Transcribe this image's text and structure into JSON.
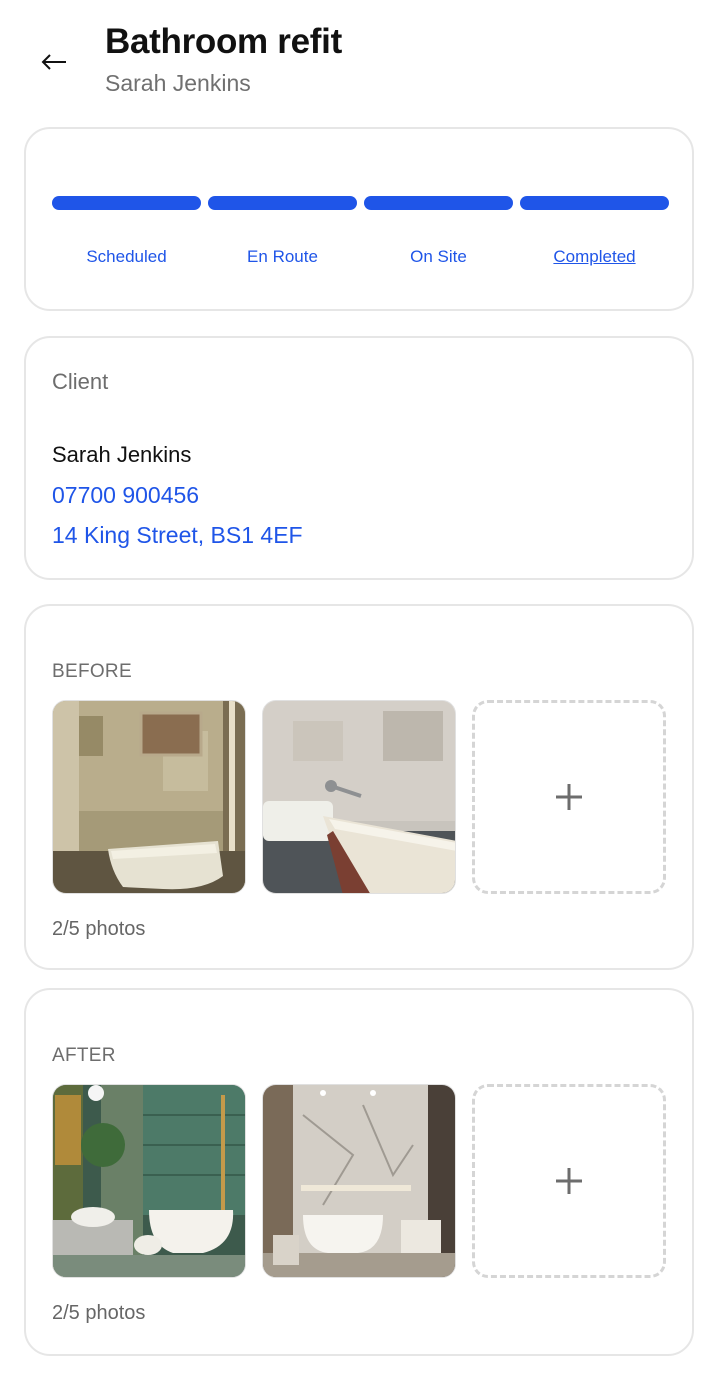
{
  "header": {
    "title": "Bathroom refit",
    "subtitle": "Sarah Jenkins",
    "back_icon": "arrow-left-icon"
  },
  "status": {
    "steps": [
      "Scheduled",
      "En Route",
      "On Site",
      "Completed"
    ],
    "current": "Completed",
    "completed_steps": 4,
    "accent_color": "#1f55e8"
  },
  "client": {
    "label": "Client",
    "name": "Sarah Jenkins",
    "phone": "07700 900456",
    "address": "14 King Street, BS1 4EF"
  },
  "before": {
    "label": "BEFORE",
    "count": "2/5 photos",
    "add_icon": "plus-icon"
  },
  "after": {
    "label": "AFTER",
    "count": "2/5 photos",
    "add_icon": "plus-icon"
  }
}
